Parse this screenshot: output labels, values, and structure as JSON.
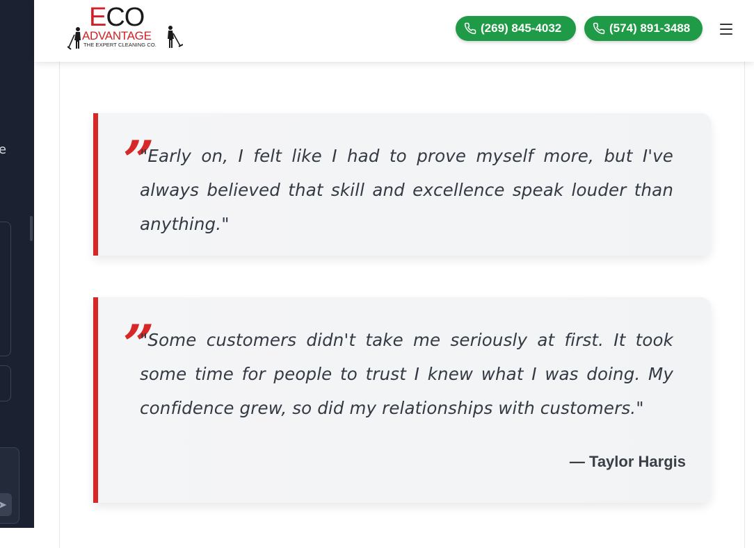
{
  "side_panel": {
    "edge_text": "e",
    "send_icon": "arrow-right-icon"
  },
  "header": {
    "logo": {
      "word_eco_first": "E",
      "word_eco_rest": "CO",
      "word_advantage": "ADVANTAGE",
      "tagline": "THE EXPERT CLEANING CO."
    },
    "phone_buttons": [
      {
        "label": "(269) 845-4032",
        "icon": "phone-icon"
      },
      {
        "label": "(574) 891-3488",
        "icon": "phone-icon"
      }
    ],
    "menu_icon": "hamburger-menu-icon"
  },
  "quotes": [
    {
      "mark": "”",
      "text": "\"Early on, I felt like I had to prove myself more, but I've always believed that skill and excellence speak louder than anything.\""
    },
    {
      "mark": "”",
      "text": "\"Some customers didn't take me seriously at first. It took some time for people to trust I knew what I was doing. My confidence grew, so did my relationships with customers.\"",
      "attribution": "— Taylor Hargis"
    }
  ],
  "colors": {
    "accent_red": "#d62828",
    "phone_green": "#1f9a46",
    "side_panel": "#1b2130"
  }
}
